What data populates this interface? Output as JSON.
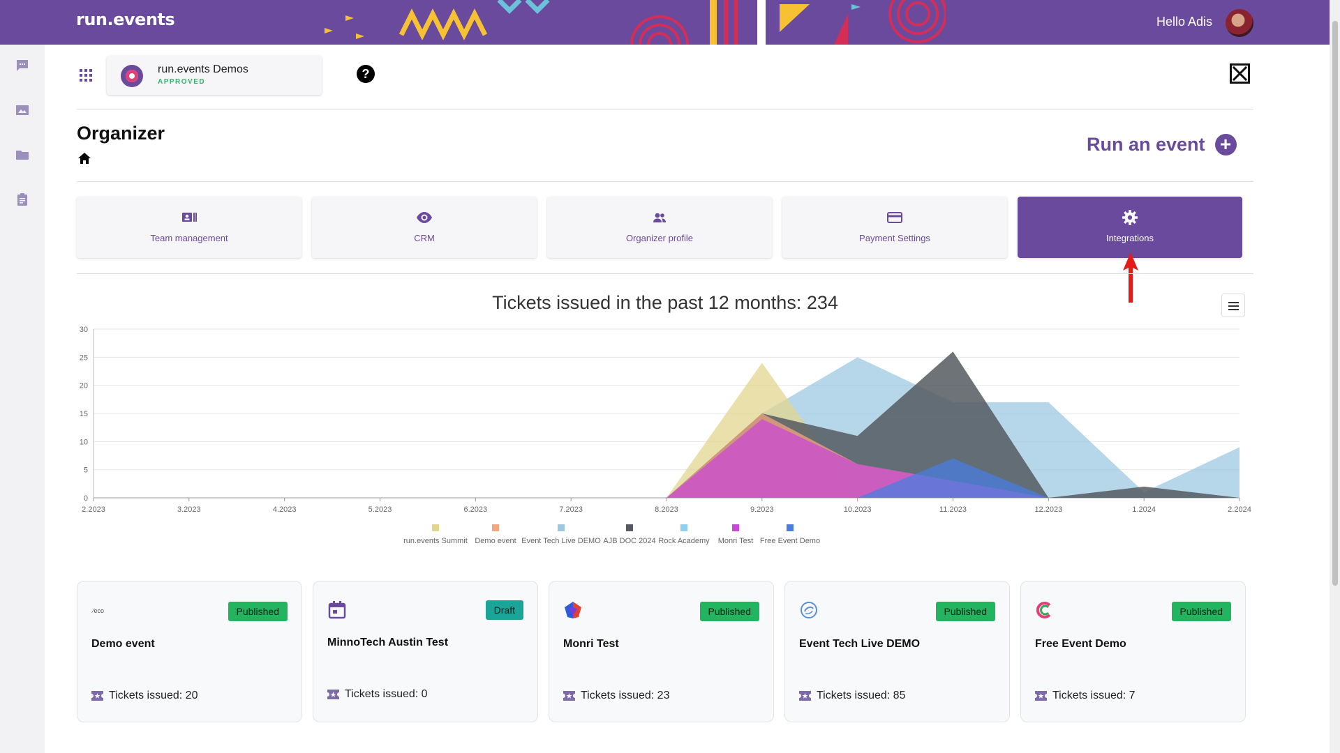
{
  "header": {
    "logo_text": "run.events",
    "greeting": "Hello Adis",
    "brand_color": "#6a4a9c"
  },
  "rail": {
    "items": [
      "chat-icon",
      "image-icon",
      "folder-icon",
      "clipboard-icon"
    ]
  },
  "organization": {
    "name": "run.events Demos",
    "status": "APPROVED"
  },
  "page": {
    "title": "Organizer",
    "run_event_label": "Run an event"
  },
  "tiles": [
    {
      "label": "Team management",
      "icon": "id-card-icon",
      "active": false
    },
    {
      "label": "CRM",
      "icon": "eye-icon",
      "active": false
    },
    {
      "label": "Organizer profile",
      "icon": "people-icon",
      "active": false
    },
    {
      "label": "Payment Settings",
      "icon": "credit-card-icon",
      "active": false
    },
    {
      "label": "Integrations",
      "icon": "gear-icon",
      "active": true
    }
  ],
  "chart_data": {
    "type": "area",
    "title": "Tickets issued in the past 12 months: 234",
    "categories": [
      "2.2023",
      "3.2023",
      "4.2023",
      "5.2023",
      "6.2023",
      "7.2023",
      "8.2023",
      "9.2023",
      "10.2023",
      "11.2023",
      "12.2023",
      "1.2024",
      "2.2024"
    ],
    "ylim": [
      0,
      30
    ],
    "yticks": [
      0,
      5,
      10,
      15,
      20,
      25,
      30
    ],
    "grid": true,
    "legend_position": "bottom",
    "series": [
      {
        "name": "run.events Summit",
        "color": "#e2d58f",
        "values": [
          0,
          0,
          0,
          0,
          0,
          0,
          0,
          24,
          0,
          0,
          0,
          0,
          0
        ]
      },
      {
        "name": "Demo event",
        "color": "#f4a582",
        "values": [
          0,
          0,
          0,
          0,
          0,
          0,
          0,
          15,
          6,
          3,
          0,
          0,
          0
        ]
      },
      {
        "name": "Event Tech Live DEMO",
        "color": "#9ec8e2",
        "values": [
          0,
          0,
          0,
          0,
          0,
          0,
          0,
          15,
          25,
          17,
          17,
          1,
          9
        ]
      },
      {
        "name": "AJB DOC 2024",
        "color": "#555b60",
        "values": [
          0,
          0,
          0,
          0,
          0,
          0,
          0,
          15,
          11,
          26,
          0,
          2,
          0
        ]
      },
      {
        "name": "Rock Academy",
        "color": "#8fd0ef",
        "values": [
          0,
          0,
          0,
          0,
          0,
          0,
          0,
          0,
          0,
          0,
          0,
          0,
          0
        ]
      },
      {
        "name": "Monri Test",
        "color": "#c94ad6",
        "values": [
          0,
          0,
          0,
          0,
          0,
          0,
          0,
          14,
          6,
          3,
          0,
          0,
          0
        ]
      },
      {
        "name": "Free Event Demo",
        "color": "#4a7de0",
        "values": [
          0,
          0,
          0,
          0,
          0,
          0,
          0,
          0,
          0,
          7,
          0,
          0,
          0
        ]
      }
    ]
  },
  "events": [
    {
      "name": "Demo event",
      "status": "Published",
      "tickets": "Tickets issued: 20",
      "logo": "eco-logo-icon"
    },
    {
      "name": "MinnoTech Austin Test",
      "status": "Draft",
      "tickets": "Tickets issued: 0",
      "logo": "calendar-icon"
    },
    {
      "name": "Monri Test",
      "status": "Published",
      "tickets": "Tickets issued: 23",
      "logo": "monri-logo-icon"
    },
    {
      "name": "Event Tech Live DEMO",
      "status": "Published",
      "tickets": "Tickets issued: 85",
      "logo": "etl-logo-icon"
    },
    {
      "name": "Free Event Demo",
      "status": "Published",
      "tickets": "Tickets issued: 7",
      "logo": "c-logo-icon"
    }
  ]
}
